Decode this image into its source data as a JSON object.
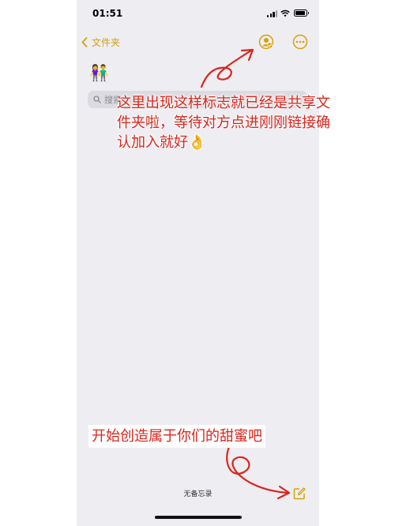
{
  "status_bar": {
    "time": "01:51"
  },
  "nav": {
    "back_label": "文件夹",
    "share_icon": "person-crop-circle-checkmark-icon",
    "more_icon": "ellipsis-circle-icon"
  },
  "folder": {
    "title": "👫"
  },
  "search": {
    "placeholder": "搜索"
  },
  "annotations": {
    "caption_top": "这里出现这样标志就已经是共享文件夹啦，等待对方点进刚刚链接确认加入就好👌",
    "caption_bottom": "开始创造属于你们的甜蜜吧"
  },
  "toolbar": {
    "note_count": "无备忘录",
    "compose_icon": "square-and-pencil-icon"
  },
  "colors": {
    "accent": "#d4a20a",
    "annotation_red": "#d9261c",
    "background": "#eeedf2"
  }
}
